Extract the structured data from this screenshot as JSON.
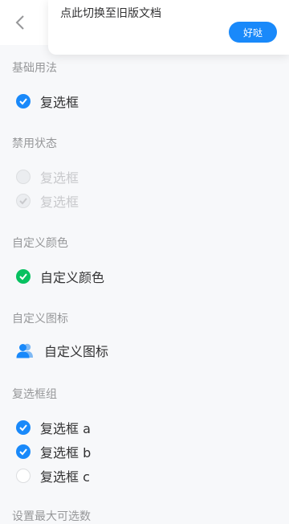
{
  "toast": {
    "message": "点此切换至旧版文档",
    "button": "好哒"
  },
  "sections": {
    "basic": {
      "title": "基础用法",
      "item": "复选框"
    },
    "disabled": {
      "title": "禁用状态",
      "item1": "复选框",
      "item2": "复选框"
    },
    "custom_color": {
      "title": "自定义颜色",
      "item": "自定义颜色"
    },
    "custom_icon": {
      "title": "自定义图标",
      "item": "自定义图标"
    },
    "group": {
      "title": "复选框组",
      "items": [
        "复选框 a",
        "复选框 b",
        "复选框 c"
      ]
    },
    "next": {
      "title": "设置最大可选数"
    }
  },
  "colors": {
    "primary": "#1989fa",
    "success": "#07c160",
    "muted": "#969799"
  }
}
